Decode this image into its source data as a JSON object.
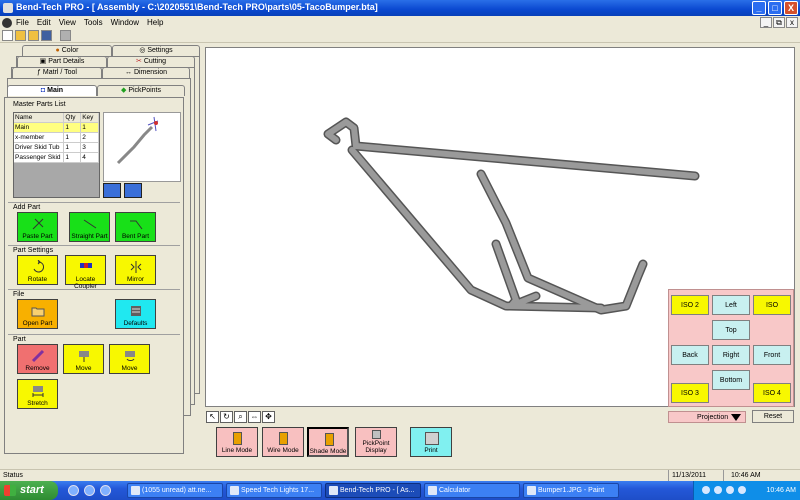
{
  "window": {
    "title": "Bend-Tech PRO - [ Assembly - C:\\2020551\\Bend-Tech PRO\\parts\\05-TacoBumper.bta]",
    "buttons": {
      "minimize": "_",
      "maximize": "□",
      "close": "X"
    }
  },
  "menu": {
    "items": [
      "File",
      "Edit",
      "View",
      "Tools",
      "Window",
      "Help"
    ],
    "mdi": {
      "minimize": "_",
      "restore": "⧉",
      "close": "x"
    }
  },
  "tabs": {
    "row1": [
      "Color",
      "Settings"
    ],
    "row2": [
      "Part Details",
      "Cutting"
    ],
    "row3": [
      "Matrl / Tool",
      "Dimension"
    ],
    "row4": [
      "Main",
      "PickPoints"
    ]
  },
  "main": {
    "master_parts_label": "Master Parts List",
    "parts_table": {
      "headers": [
        "Name",
        "Qty",
        "Key"
      ],
      "rows": [
        [
          "Main",
          "1",
          "1"
        ],
        [
          "x-member",
          "1",
          "2"
        ],
        [
          "Driver Skid Tub",
          "1",
          "3"
        ],
        [
          "Passenger Skid",
          "1",
          "4"
        ]
      ]
    },
    "add_part": {
      "label": "Add Part",
      "buttons": [
        "Paste Part",
        "Straight Part",
        "Bent Part"
      ]
    },
    "part_settings": {
      "label": "Part Settings",
      "buttons": [
        "Rotate",
        "Locate Coupler",
        "Mirror"
      ]
    },
    "file": {
      "label": "File",
      "buttons": [
        "Open Part",
        "Defaults"
      ]
    },
    "part": {
      "label": "Part",
      "buttons": [
        "Remove",
        "Move",
        "Move",
        "Stretch"
      ]
    }
  },
  "view_pad": {
    "iso2": "ISO 2",
    "left": "Left",
    "iso": "ISO",
    "top": "Top",
    "back": "Back",
    "right": "Right",
    "front": "Front",
    "bottom": "Bottom",
    "iso3": "ISO 3",
    "iso4": "ISO 4"
  },
  "bottom_controls": {
    "projection": "Projection",
    "reset": "Reset",
    "modes": [
      "Line Mode",
      "Wire Mode",
      "Shade Mode",
      "PickPoint Display",
      "Print"
    ]
  },
  "status": {
    "text": "Status",
    "date": "11/13/2011",
    "time": "10:46 AM"
  },
  "taskbar": {
    "start": "start",
    "tasks": [
      "(1055 unread) att.ne...",
      "Speed Tech Lights 17...",
      "Bend-Tech PRO - [ As...",
      "Calculator",
      "Bumper1.JPG - Paint"
    ],
    "clock": "10:46 AM"
  },
  "colors": {
    "tube": "#8a8a8a",
    "green_button": "#18e018",
    "yellow_button": "#f8f800",
    "cyan_button": "#20e8f0",
    "view_pad": "#f8c8c8"
  }
}
